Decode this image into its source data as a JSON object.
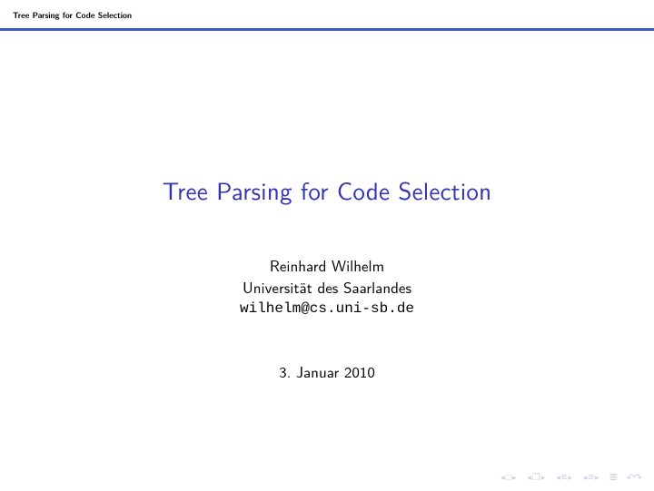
{
  "header": {
    "breadcrumb": "Tree Parsing for Code Selection"
  },
  "title": "Tree Parsing for Code Selection",
  "author": {
    "name": "Reinhard Wilhelm",
    "affiliation": "Universität des Saarlandes",
    "email": "wilhelm@cs.uni-sb.de"
  },
  "date": "3. Januar 2010",
  "nav": {
    "frame_icon": "□",
    "subframe_icon": "❐",
    "section_icon": "≡",
    "subsection_icon": "≡",
    "appendix_icon": "≣",
    "back_icon": "↶↷"
  }
}
